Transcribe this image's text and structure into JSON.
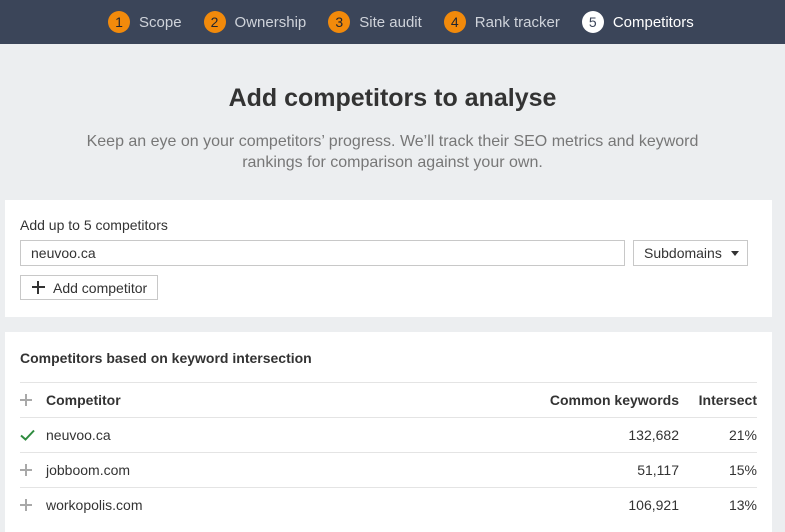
{
  "steps": [
    {
      "number": "1",
      "label": "Scope"
    },
    {
      "number": "2",
      "label": "Ownership"
    },
    {
      "number": "3",
      "label": "Site audit"
    },
    {
      "number": "4",
      "label": "Rank tracker"
    },
    {
      "number": "5",
      "label": "Competitors"
    }
  ],
  "hero": {
    "title": "Add competitors to analyse",
    "subtitle": "Keep an eye on your competitors’ progress. We’ll track their SEO metrics and keyword rankings for comparison against your own."
  },
  "add_card": {
    "label": "Add up to 5 competitors",
    "input_value": "neuvoo.ca",
    "mode_select": "Subdomains",
    "add_button": "Add competitor"
  },
  "list": {
    "title": "Competitors based on keyword intersection",
    "columns": [
      "Competitor",
      "Common keywords",
      "Intersect"
    ],
    "rows": [
      {
        "name": "neuvoo.ca",
        "common_keywords": "132,682",
        "intersect": "21%",
        "selected": true
      },
      {
        "name": "jobboom.com",
        "common_keywords": "51,117",
        "intersect": "15%",
        "selected": false
      },
      {
        "name": "workopolis.com",
        "common_keywords": "106,921",
        "intersect": "13%",
        "selected": false
      }
    ]
  },
  "colors": {
    "header_bg": "#3b4559",
    "step_badge": "#f28a0b",
    "check_green": "#2e8b3e"
  }
}
